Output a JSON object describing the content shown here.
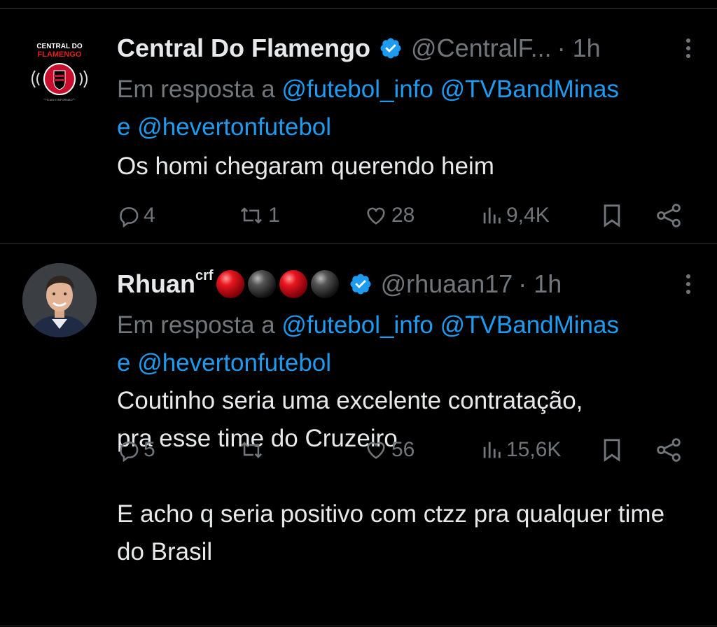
{
  "tweets": [
    {
      "name": "Central Do Flamengo",
      "name_suffix": "",
      "handle": "@CentralF...",
      "time": "· 1h",
      "reply_prefix": "Em resposta a",
      "reply_mentions_1": "@futebol_info @TVBandMinas",
      "reply_and": "e",
      "reply_mentions_2": "@hevertonfutebol",
      "text": "Os homi chegaram querendo heim",
      "replies": "4",
      "reposts": "1",
      "likes": "28",
      "views": "9,4K",
      "avatar": {
        "logo_line1": "CENTRAL DO",
        "logo_line2": "FLAMENGO",
        "logo_tagline": "NOTÍCIAS E INFORMAÇÕES"
      }
    },
    {
      "name": "Rhuan",
      "name_suffix": "crf",
      "emoji_balls": [
        "red-ball",
        "black-ball",
        "red-ball",
        "black-ball"
      ],
      "handle": "@rhuaan17",
      "time": "· 1h",
      "reply_prefix": "Em resposta a",
      "reply_mentions_1": "@futebol_info @TVBandMinas",
      "reply_and": "e",
      "reply_mentions_2": "@hevertonfutebol",
      "text": "Coutinho seria uma excelente contratação,\npra esse time do Cruzeiro\n\nE acho q seria positivo com ctzz pra qualquer time do Brasil",
      "replies": "5",
      "reposts": "",
      "likes": "56",
      "views": "15,6K"
    }
  ],
  "colors": {
    "background": "#000000",
    "text": "#e7e9ea",
    "muted": "#71767b",
    "link": "#1d9bf0",
    "verified": "#1d9bf0",
    "divider": "#2f3336"
  }
}
